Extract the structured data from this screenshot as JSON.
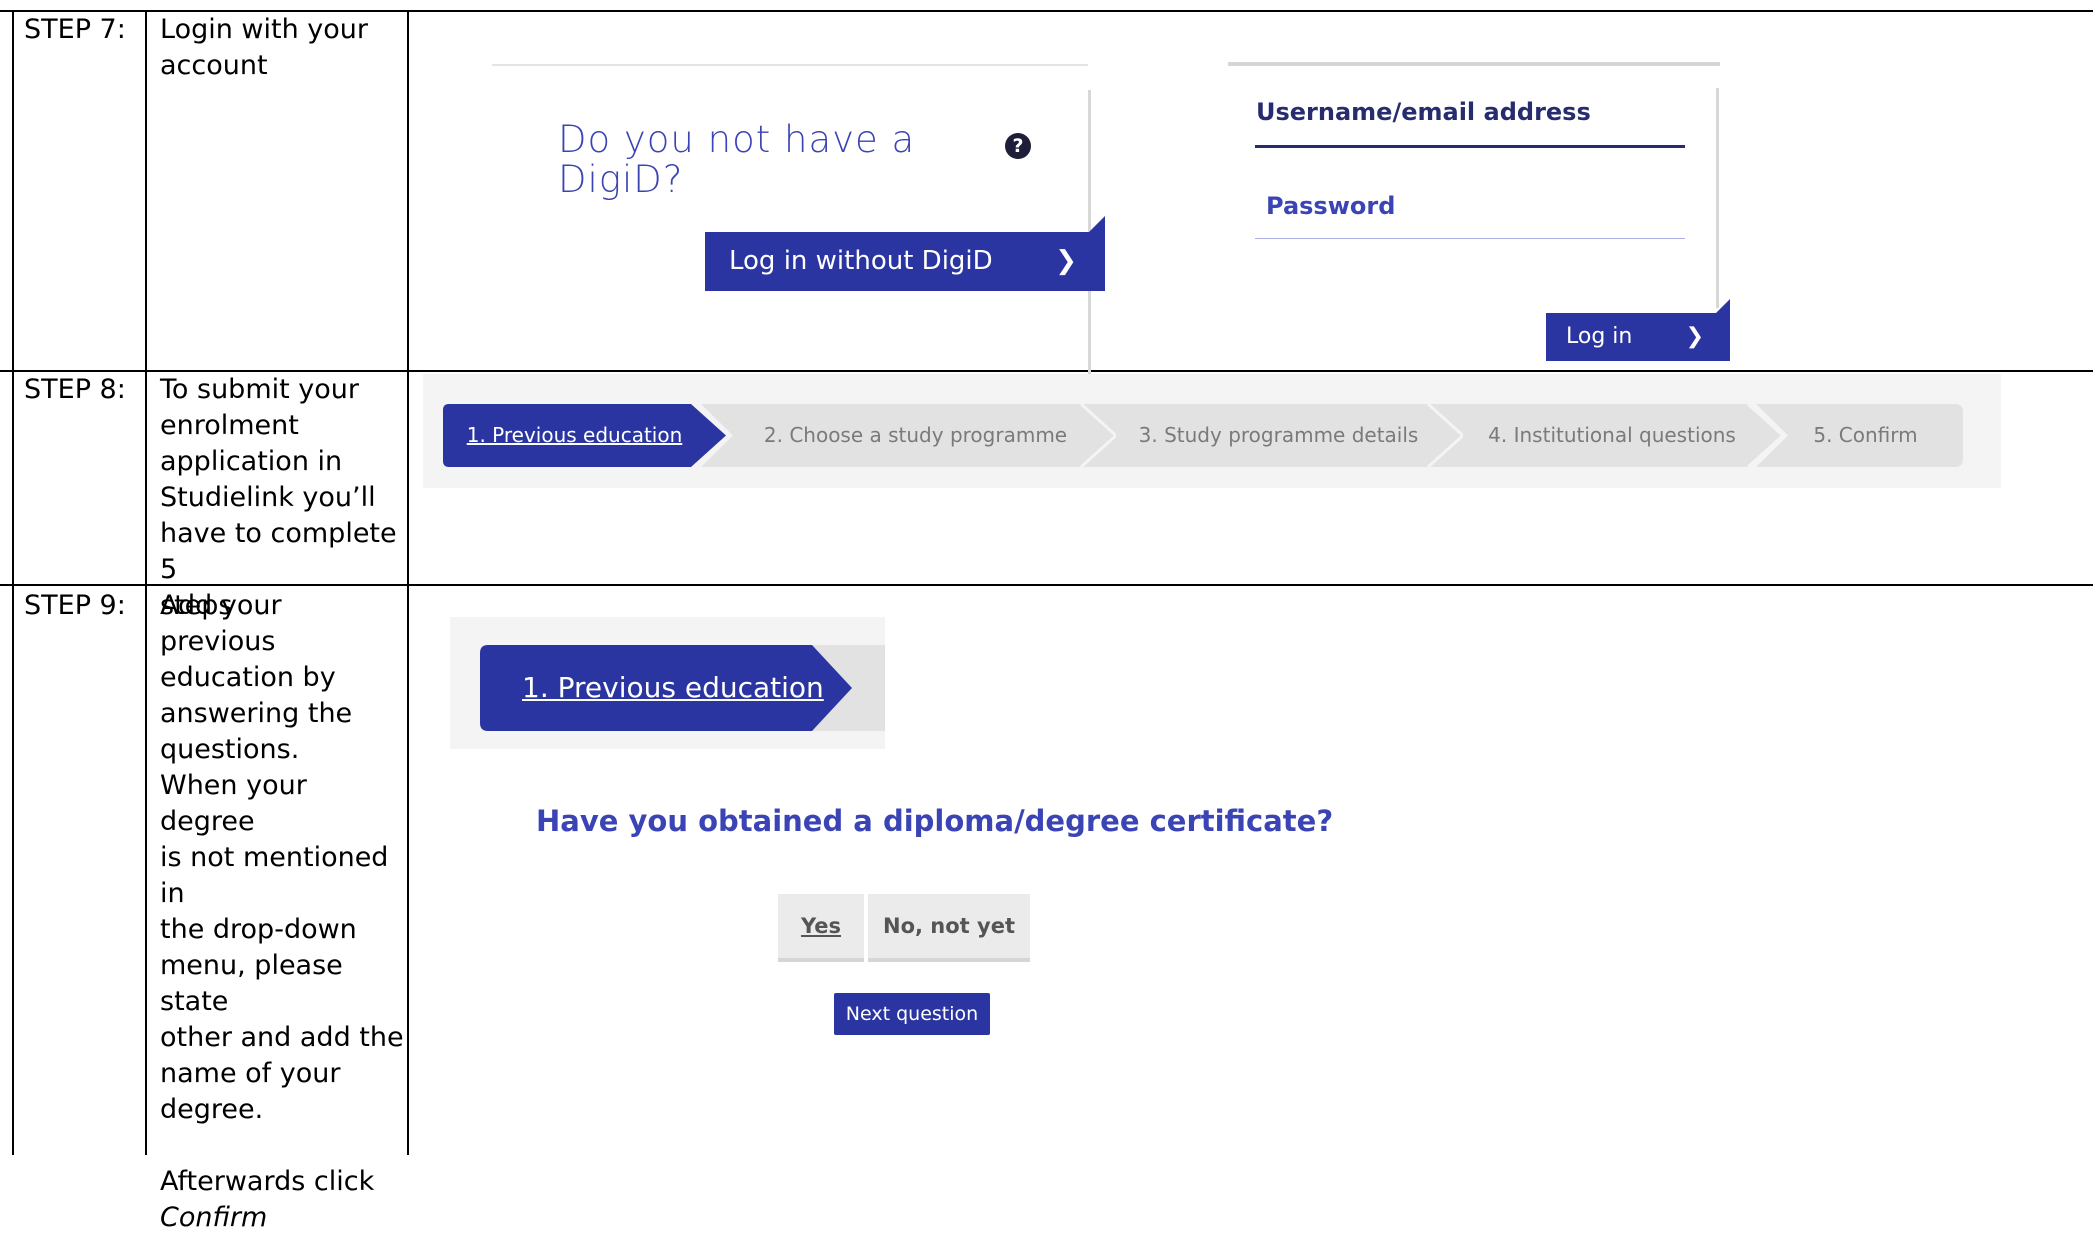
{
  "steps": [
    {
      "label": "STEP 7:",
      "description": [
        "Login with your",
        "account"
      ]
    },
    {
      "label": "STEP 8:",
      "description": [
        "To submit your",
        "enrolment",
        "application in",
        "Studielink you’ll",
        "have to complete 5",
        "steps"
      ]
    },
    {
      "label": "STEP 9:",
      "description": [
        "Add your previous",
        "education by",
        "answering the",
        "questions.",
        "When your degree",
        "is not mentioned in",
        "the drop-down",
        "menu, please state",
        "other and add the",
        "name of your",
        "degree.",
        "",
        "Afterwards click"
      ],
      "emphasis": "Confirm"
    }
  ],
  "login": {
    "no_digid_question": "Do you not have a DigiD?",
    "help_icon": "question-circle-icon",
    "login_without_digid": "Log in without DigiD",
    "username_label": "Username/email address",
    "password_label": "Password",
    "login_button": "Log in",
    "chevron_glyph": "❯"
  },
  "stepper": {
    "items": [
      {
        "label": "1. Previous education",
        "active": true
      },
      {
        "label": "2. Choose a study programme",
        "active": false
      },
      {
        "label": "3. Study programme details",
        "active": false
      },
      {
        "label": "4. Institutional questions",
        "active": false
      },
      {
        "label": "5. Confirm",
        "active": false
      }
    ]
  },
  "previous_education": {
    "active_step": "1. Previous education",
    "question": "Have you obtained a diploma/degree certificate?",
    "choices": [
      "Yes",
      "No, not yet"
    ],
    "next_button": "Next question"
  },
  "colors": {
    "primary": "#2a35a1",
    "accent_text": "#3b44b5",
    "inactive_step": "#e2e2e2"
  }
}
